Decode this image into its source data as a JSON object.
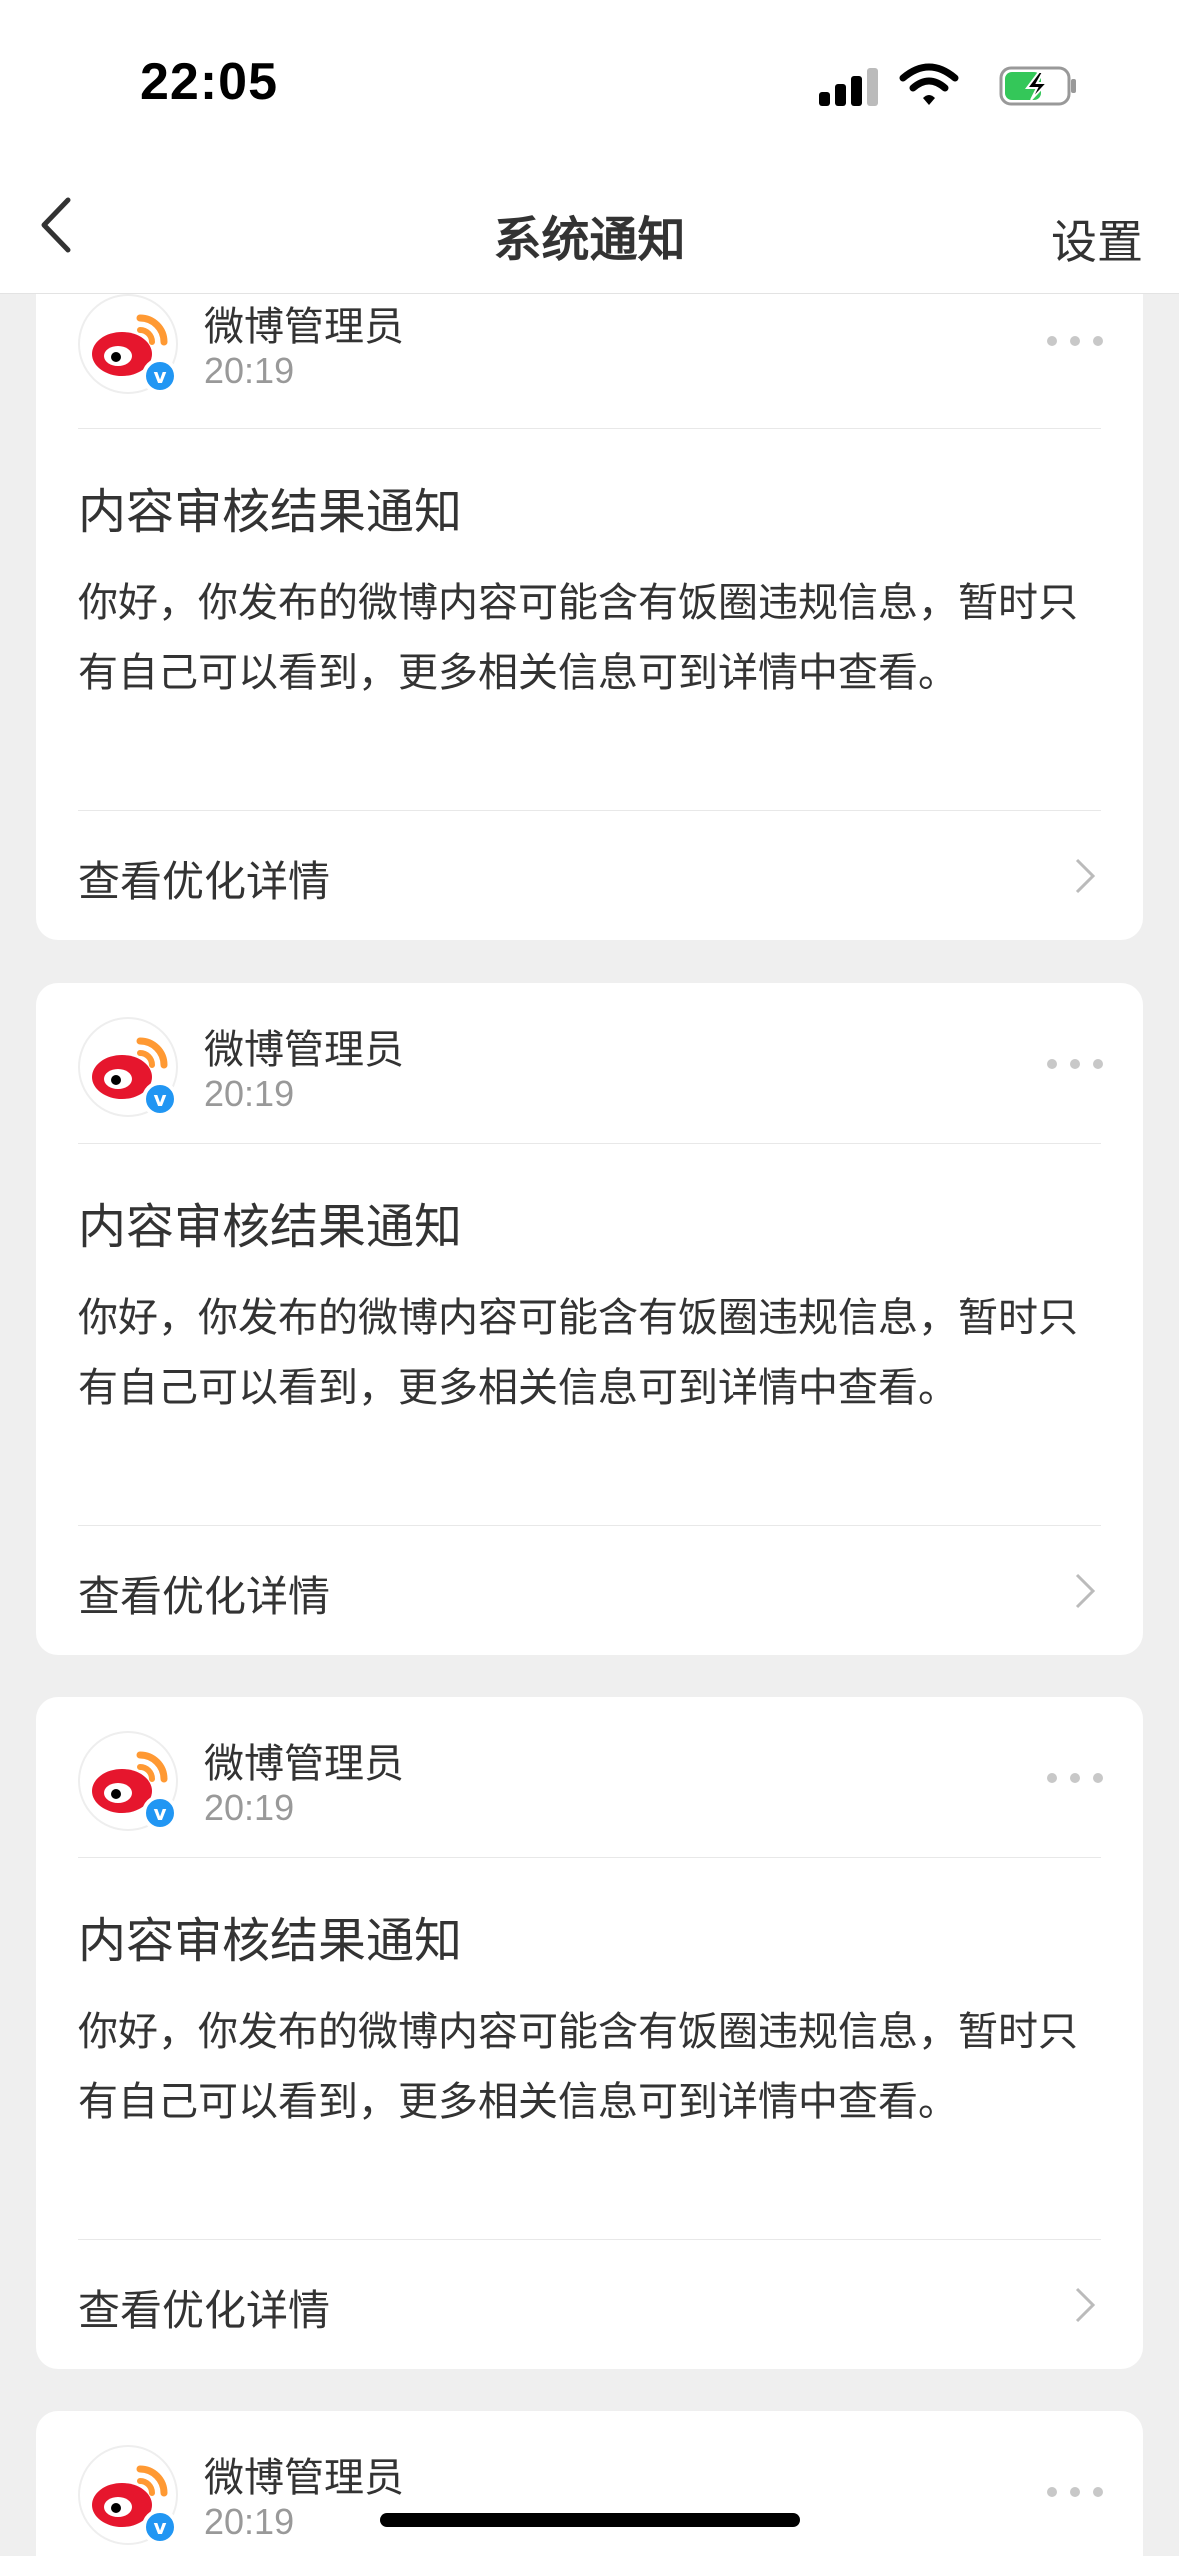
{
  "status_bar": {
    "time": "22:05"
  },
  "nav": {
    "title": "系统通知",
    "settings_label": "设置"
  },
  "notifications": [
    {
      "sender": "微博管理员",
      "time": "20:19",
      "title": "内容审核结果通知",
      "body": "你好，你发布的微博内容可能含有饭圈违规信息，暂时只有自己可以看到，更多相关信息可到详情中查看。",
      "link_label": "查看优化详情"
    },
    {
      "sender": "微博管理员",
      "time": "20:19",
      "title": "内容审核结果通知",
      "body": "你好，你发布的微博内容可能含有饭圈违规信息，暂时只有自己可以看到，更多相关信息可到详情中查看。",
      "link_label": "查看优化详情"
    },
    {
      "sender": "微博管理员",
      "time": "20:19",
      "title": "内容审核结果通知",
      "body": "你好，你发布的微博内容可能含有饭圈违规信息，暂时只有自己可以看到，更多相关信息可到详情中查看。",
      "link_label": "查看优化详情"
    },
    {
      "sender": "微博管理员",
      "time": "20:19"
    }
  ],
  "colors": {
    "brand_red": "#e6162d",
    "brand_orange": "#ff9933",
    "verified_blue": "#2196f3"
  },
  "icons": {
    "back": "chevron-left-icon",
    "more": "more-dots-icon",
    "link_arrow": "chevron-right-icon",
    "avatar": "weibo-logo-icon",
    "verified": "verified-badge-icon"
  }
}
